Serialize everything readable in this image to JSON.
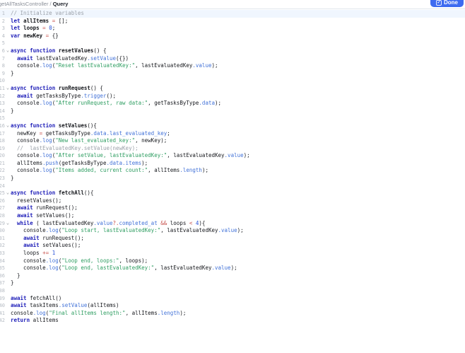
{
  "header": {
    "breadcrumb_parent": "getAllTasksController",
    "breadcrumb_separator": " / ",
    "breadcrumb_current": "Query",
    "done_button": {
      "label": "Done",
      "icon": "check-icon"
    }
  },
  "palette": {
    "keyword": "#1d1db8",
    "definition": "#15171c",
    "property": "#4272d8",
    "string": "#2f9e62",
    "number": "#2750d8",
    "operator": "#c7504b",
    "comment": "#9ba1a9",
    "text": "#16181d",
    "active_line_bg": "#f0f6fe",
    "button_bg": "#3e6bf0"
  },
  "editor": {
    "language": "javascript",
    "active_line": 1,
    "fold_lines": [
      6,
      11,
      16,
      25,
      29
    ],
    "fold_icon": "chevron-down-icon",
    "lines": [
      [
        [
          "c",
          "// Initialize variables"
        ]
      ],
      [
        [
          "k",
          "let"
        ],
        [
          "t",
          " "
        ],
        [
          "d",
          "allItems"
        ],
        [
          "t",
          " "
        ],
        [
          "o",
          "="
        ],
        [
          "t",
          " [];"
        ]
      ],
      [
        [
          "k",
          "let"
        ],
        [
          "t",
          " "
        ],
        [
          "d",
          "loops"
        ],
        [
          "t",
          " "
        ],
        [
          "o",
          "="
        ],
        [
          "t",
          " "
        ],
        [
          "n",
          "0"
        ],
        [
          "t",
          ";"
        ]
      ],
      [
        [
          "k",
          "var"
        ],
        [
          "t",
          " "
        ],
        [
          "d",
          "newKey"
        ],
        [
          "t",
          " "
        ],
        [
          "o",
          "="
        ],
        [
          "t",
          " {}"
        ]
      ],
      [],
      [
        [
          "k",
          "async"
        ],
        [
          "t",
          " "
        ],
        [
          "k",
          "function"
        ],
        [
          "t",
          " "
        ],
        [
          "d",
          "resetValues"
        ],
        [
          "t",
          "() {"
        ]
      ],
      [
        [
          "t",
          "  "
        ],
        [
          "k",
          "await"
        ],
        [
          "t",
          " lastEvaluatedKey"
        ],
        [
          "p",
          ".setValue"
        ],
        [
          "t",
          "({})"
        ]
      ],
      [
        [
          "t",
          "  console"
        ],
        [
          "p",
          ".log"
        ],
        [
          "t",
          "("
        ],
        [
          "s",
          "\"Reset lastEvaluatedKey:\""
        ],
        [
          "t",
          ", lastEvaluatedKey"
        ],
        [
          "p",
          ".value"
        ],
        [
          "t",
          ");"
        ]
      ],
      [
        [
          "t",
          "}"
        ]
      ],
      [],
      [
        [
          "k",
          "async"
        ],
        [
          "t",
          " "
        ],
        [
          "k",
          "function"
        ],
        [
          "t",
          " "
        ],
        [
          "d",
          "runRequest"
        ],
        [
          "t",
          "() {"
        ]
      ],
      [
        [
          "t",
          "  "
        ],
        [
          "k",
          "await"
        ],
        [
          "t",
          " getTasksByType"
        ],
        [
          "p",
          ".trigger"
        ],
        [
          "t",
          "();"
        ]
      ],
      [
        [
          "t",
          "  console"
        ],
        [
          "p",
          ".log"
        ],
        [
          "t",
          "("
        ],
        [
          "s",
          "\"After runRequest, raw data:\""
        ],
        [
          "t",
          ", getTasksByType"
        ],
        [
          "p",
          ".data"
        ],
        [
          "t",
          ");"
        ]
      ],
      [
        [
          "t",
          "}"
        ]
      ],
      [],
      [
        [
          "k",
          "async"
        ],
        [
          "t",
          " "
        ],
        [
          "k",
          "function"
        ],
        [
          "t",
          " "
        ],
        [
          "d",
          "setValues"
        ],
        [
          "t",
          "(){"
        ]
      ],
      [
        [
          "t",
          "  newKey "
        ],
        [
          "o",
          "="
        ],
        [
          "t",
          " getTasksByType"
        ],
        [
          "p",
          ".data"
        ],
        [
          "p",
          ".last_evaluated_key"
        ],
        [
          "t",
          ";"
        ]
      ],
      [
        [
          "t",
          "  console"
        ],
        [
          "p",
          ".log"
        ],
        [
          "t",
          "("
        ],
        [
          "s",
          "\"New last_evaluated_key:\""
        ],
        [
          "t",
          ", newKey);"
        ]
      ],
      [
        [
          "t",
          "  "
        ],
        [
          "c",
          "//  lastEvaluatedKey.setValue(newKey);"
        ]
      ],
      [
        [
          "t",
          "  console"
        ],
        [
          "p",
          ".log"
        ],
        [
          "t",
          "("
        ],
        [
          "s",
          "\"After setValue, lastEvaluatedKey:\""
        ],
        [
          "t",
          ", lastEvaluatedKey"
        ],
        [
          "p",
          ".value"
        ],
        [
          "t",
          ");"
        ]
      ],
      [
        [
          "t",
          "  allItems"
        ],
        [
          "p",
          ".push"
        ],
        [
          "t",
          "(getTasksByType"
        ],
        [
          "p",
          ".data"
        ],
        [
          "p",
          ".items"
        ],
        [
          "t",
          ");"
        ]
      ],
      [
        [
          "t",
          "  console"
        ],
        [
          "p",
          ".log"
        ],
        [
          "t",
          "("
        ],
        [
          "s",
          "\"Items added, current count:\""
        ],
        [
          "t",
          ", allItems"
        ],
        [
          "p",
          ".length"
        ],
        [
          "t",
          ");"
        ]
      ],
      [
        [
          "t",
          "}"
        ]
      ],
      [],
      [
        [
          "k",
          "async"
        ],
        [
          "t",
          " "
        ],
        [
          "k",
          "function"
        ],
        [
          "t",
          " "
        ],
        [
          "d",
          "fetchAll"
        ],
        [
          "t",
          "(){"
        ]
      ],
      [
        [
          "t",
          "  resetValues();"
        ]
      ],
      [
        [
          "t",
          "  "
        ],
        [
          "k",
          "await"
        ],
        [
          "t",
          " runRequest();"
        ]
      ],
      [
        [
          "t",
          "  "
        ],
        [
          "k",
          "await"
        ],
        [
          "t",
          " setValues();"
        ]
      ],
      [
        [
          "t",
          "  "
        ],
        [
          "k",
          "while"
        ],
        [
          "t",
          " ( lastEvaluatedKey"
        ],
        [
          "p",
          ".value"
        ],
        [
          "o",
          "?."
        ],
        [
          "p",
          "completed_at"
        ],
        [
          "t",
          " "
        ],
        [
          "o",
          "&&"
        ],
        [
          "t",
          " loops "
        ],
        [
          "o",
          "<"
        ],
        [
          "t",
          " "
        ],
        [
          "n",
          "4"
        ],
        [
          "t",
          "){"
        ]
      ],
      [
        [
          "t",
          "    console"
        ],
        [
          "p",
          ".log"
        ],
        [
          "t",
          "("
        ],
        [
          "s",
          "\"Loop start, lastEvaluatedKey:\""
        ],
        [
          "t",
          ", lastEvaluatedKey"
        ],
        [
          "p",
          ".value"
        ],
        [
          "t",
          ");"
        ]
      ],
      [
        [
          "t",
          "    "
        ],
        [
          "k",
          "await"
        ],
        [
          "t",
          " runRequest();"
        ]
      ],
      [
        [
          "t",
          "    "
        ],
        [
          "k",
          "await"
        ],
        [
          "t",
          " setValues();"
        ]
      ],
      [
        [
          "t",
          "    loops "
        ],
        [
          "o",
          "+="
        ],
        [
          "t",
          " "
        ],
        [
          "n",
          "1"
        ]
      ],
      [
        [
          "t",
          "    console"
        ],
        [
          "p",
          ".log"
        ],
        [
          "t",
          "("
        ],
        [
          "s",
          "\"Loop end, loops:\""
        ],
        [
          "t",
          ", loops);"
        ]
      ],
      [
        [
          "t",
          "    console"
        ],
        [
          "p",
          ".log"
        ],
        [
          "t",
          "("
        ],
        [
          "s",
          "\"Loop end, lastEvaluatedKey:\""
        ],
        [
          "t",
          ", lastEvaluatedKey"
        ],
        [
          "p",
          ".value"
        ],
        [
          "t",
          ");"
        ]
      ],
      [
        [
          "t",
          "  }"
        ]
      ],
      [
        [
          "t",
          "}"
        ]
      ],
      [],
      [
        [
          "k",
          "await"
        ],
        [
          "t",
          " fetchAll()"
        ]
      ],
      [
        [
          "k",
          "await"
        ],
        [
          "t",
          " taskItems"
        ],
        [
          "p",
          ".setValue"
        ],
        [
          "t",
          "(allItems)"
        ]
      ],
      [
        [
          "t",
          "console"
        ],
        [
          "p",
          ".log"
        ],
        [
          "t",
          "("
        ],
        [
          "s",
          "\"Final allItems length:\""
        ],
        [
          "t",
          ", allItems"
        ],
        [
          "p",
          ".length"
        ],
        [
          "t",
          ");"
        ]
      ],
      [
        [
          "k",
          "return"
        ],
        [
          "t",
          " allItems"
        ]
      ]
    ]
  }
}
